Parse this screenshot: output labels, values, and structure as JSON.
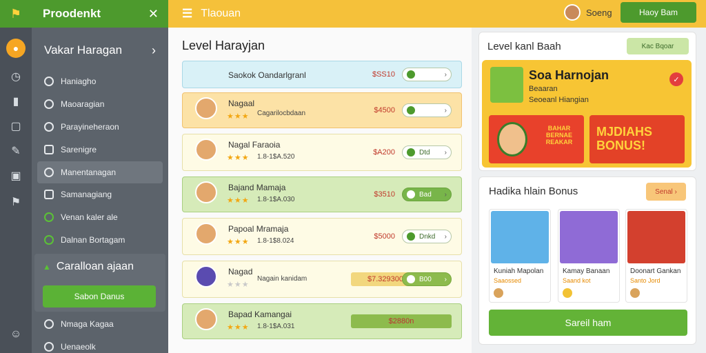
{
  "app": {
    "title": "Proodenkt",
    "section_title": "Tlaouan"
  },
  "topbar": {
    "user_name": "Soeng",
    "button_label": "Haoy Bam"
  },
  "sidebar": {
    "header": "Vakar Haragan",
    "items": [
      {
        "label": "Haniagho",
        "icon": "clock-icon"
      },
      {
        "label": "Maoaragian",
        "icon": "circle-icon"
      },
      {
        "label": "Parayineheraon",
        "icon": "globe-icon"
      },
      {
        "label": "Sarenigre",
        "icon": "square-icon"
      },
      {
        "label": "Manentanagan",
        "icon": "target-icon"
      },
      {
        "label": "Samanagiang",
        "icon": "grid-icon"
      },
      {
        "label": "Venan kaler ale",
        "icon": "pencil-icon"
      },
      {
        "label": "Dalnan Bortagam",
        "icon": "leaf-icon"
      }
    ],
    "panel": {
      "title": "Caralloan ajaan",
      "button_label": "Sabon Danus"
    },
    "extra": [
      {
        "label": "Nmaga Kagaa"
      },
      {
        "label": "Uenaeolk"
      }
    ]
  },
  "main": {
    "title": "Level Harayjan",
    "rows": [
      {
        "name": "Saokok Oandarlgranl",
        "price": "$SS10",
        "style": "blue",
        "single": true
      },
      {
        "name": "Nagaal",
        "sub": "Cagarilocbdaan",
        "price": "$4500",
        "style": "orange"
      },
      {
        "name": "Nagal Faraoia",
        "sub": "1.8-1$A.520",
        "price": "$A200",
        "pill": "Dtd",
        "style": "cream"
      },
      {
        "name": "Bajand Mamaja",
        "sub": "1.8-1$A.030",
        "price": "$3510",
        "pill": "Bad",
        "style": "green"
      },
      {
        "name": "Papoal Mramaja",
        "sub": "1.8-1$8.024",
        "price": "$5000",
        "pill": "Dnkd",
        "style": "cream"
      },
      {
        "name": "Nagad",
        "sub": "Nagain kanidam",
        "subprice": "$7.329300",
        "pill": "B00",
        "style": "cream"
      },
      {
        "name": "Bapad Kamangai",
        "sub": "1.8-1$A.031",
        "bar": "$2880n",
        "style": "green"
      }
    ]
  },
  "promo_panel": {
    "title": "Level kanl Baah",
    "button_label": "Kac Bqoar",
    "promo_title": "Soa Harnojan",
    "promo_line1": "Beaaran",
    "promo_line2": "Seoeanl Hiangian",
    "banner1_text": "BAHAR BERNAE REAKAR",
    "banner2_text": "MJDIAHS BONUS!"
  },
  "bonus_panel": {
    "title": "Hadika hlain Bonus",
    "button_label": "Senal",
    "cards": [
      {
        "name": "Kuniah Mapolan",
        "sub": "Saaossed"
      },
      {
        "name": "Kamay Banaan",
        "sub": "Saand kot"
      },
      {
        "name": "Doonart Gankan",
        "sub": "Santo Jord"
      }
    ],
    "cta_label": "Sareil ham"
  },
  "colors": {
    "brand_green": "#4d9a2d",
    "topbar_yellow": "#f5c13a",
    "sidebar_dark": "#5c636b",
    "price_red": "#c0392b"
  }
}
